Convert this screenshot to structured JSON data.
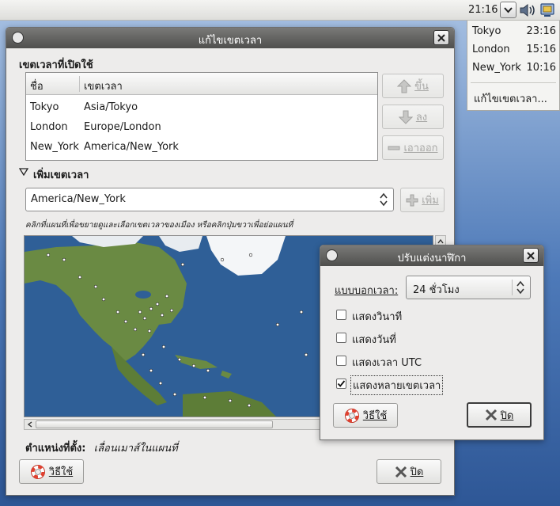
{
  "panel": {
    "clock_time": "21:16",
    "icons": [
      "chevron-down-icon",
      "volume-icon",
      "network-icon"
    ]
  },
  "clock_popup": {
    "locations": [
      {
        "city": "Tokyo",
        "time": "23:16"
      },
      {
        "city": "London",
        "time": "15:16"
      },
      {
        "city": "New_York",
        "time": "10:16"
      }
    ],
    "edit_label": "แก้ไขเขตเวลา..."
  },
  "timezone_window": {
    "title": "แก้ไขเขตเวลา",
    "active_section_label": "เขตเวลาที่เปิดใช้",
    "table": {
      "columns": [
        "ชื่อ",
        "เขตเวลา"
      ],
      "rows": [
        [
          "Tokyo",
          "Asia/Tokyo"
        ],
        [
          "London",
          "Europe/London"
        ],
        [
          "New_York",
          "America/New_York"
        ]
      ]
    },
    "buttons": {
      "up": "ขึ้น",
      "down": "ลง",
      "remove": "เอาออก",
      "add": "เพิ่ม",
      "help": "วิธีใช้",
      "close": "ปิด"
    },
    "add_section_label": "เพิ่มเขตเวลา",
    "timezone_combo_value": "America/New_York",
    "map_hint": "คลิกที่แผนที่เพื่อขยายดูและเลือกเขตเวลาของเมือง หรือคลิกปุ่มขวาเพื่อย่อแผนที่",
    "location_label": "ตำแหน่งที่ตั้ง:",
    "location_value": "เลื่อนเมาส์ในแผนที่"
  },
  "preferences_dialog": {
    "title": "ปรับแต่งนาฬิกา",
    "format_label": "แบบบอกเวลา:",
    "format_value": "24 ชั่วโมง",
    "options": [
      {
        "label": "แสดงวินาที",
        "checked": false
      },
      {
        "label": "แสดงวันที่",
        "checked": false
      },
      {
        "label": "แสดงเวลา UTC",
        "checked": false
      },
      {
        "label": "แสดงหลายเขตเวลา",
        "checked": true
      }
    ],
    "buttons": {
      "help": "วิธีใช้",
      "close": "ปิด"
    }
  },
  "colors": {
    "titlebar": "#5e5e5c",
    "window_bg": "#edeceb",
    "ocean": "#2f5f97",
    "land": "#5a7f3a",
    "ice": "#f4f6f8"
  }
}
